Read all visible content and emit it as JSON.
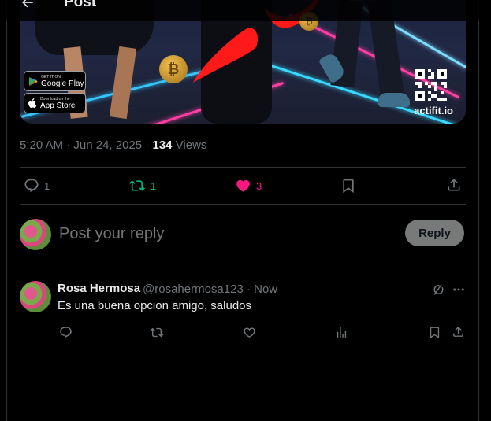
{
  "header": {
    "title": "Post"
  },
  "media": {
    "google_play_small": "GET IT ON",
    "google_play_big": "Google Play",
    "app_store_small": "Download on the",
    "app_store_big": "App Store",
    "brand": "actifit.io"
  },
  "post": {
    "time": "5:20 AM",
    "date": "Jun 24, 2025",
    "views_count": "134",
    "views_label": "Views"
  },
  "actions": {
    "replies": "1",
    "reposts": "1",
    "likes": "3"
  },
  "composer": {
    "placeholder": "Post your reply",
    "button": "Reply"
  },
  "reply": {
    "name": "Rosa Hermosa",
    "handle_time": "@rosahermosa123 · Now",
    "text": "Es una buena opcion amigo, saludos"
  },
  "colors": {
    "repost_active": "#00ba7c",
    "like_active": "#f91880",
    "muted": "#71767b",
    "reply_button_bg": "#787a7a"
  }
}
